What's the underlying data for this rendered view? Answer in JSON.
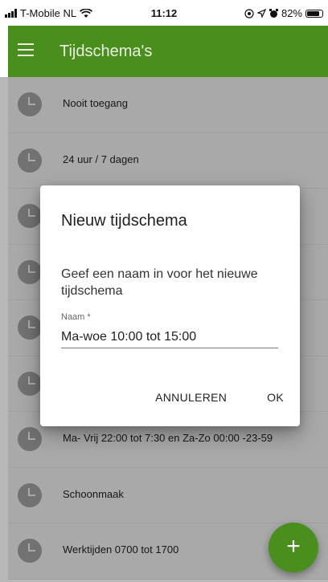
{
  "status_bar": {
    "carrier": "T-Mobile NL",
    "time": "11:12",
    "battery": "82%",
    "icons": [
      "signal-bars-icon",
      "wifi-icon",
      "location-icon",
      "alarm-icon",
      "battery-icon"
    ]
  },
  "app_bar": {
    "title": "Tijdschema's",
    "color": "#4a8e1d"
  },
  "list": {
    "items": [
      {
        "label": "Nooit toegang"
      },
      {
        "label": "24 uur / 7 dagen"
      },
      {
        "label": ""
      },
      {
        "label": ""
      },
      {
        "label": ""
      },
      {
        "label": ""
      },
      {
        "label": "Ma- Vrij 22:00 tot 7:30 en Za-Zo 00:00 -23-59"
      },
      {
        "label": "Schoonmaak"
      },
      {
        "label": "Werktijden 0700 tot 1700"
      }
    ]
  },
  "dialog": {
    "title": "Nieuw tijdschema",
    "message": "Geef een naam in voor het nieuwe tijdschema",
    "field_label": "Naam *",
    "field_value": "Ma-woe 10:00 tot 15:00",
    "cancel_label": "ANNULEREN",
    "ok_label": "OK"
  },
  "fab": {
    "symbol": "+"
  }
}
